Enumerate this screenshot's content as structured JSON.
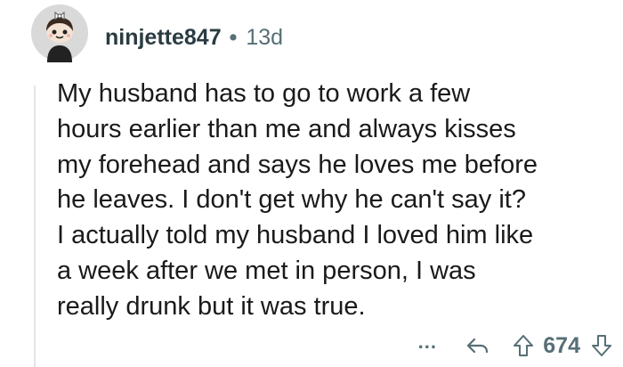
{
  "comment": {
    "author": "ninjette847",
    "separator": "•",
    "age": "13d",
    "body": "My husband has to go to work a few\nhours earlier than me and always kisses\nmy forehead and says he loves me before\nhe leaves.  I don't get why he can't say it?\nI actually told my husband I loved him like\na week after we met in person, I was\nreally drunk but it was true.",
    "avatar_icon": "snoo-avatar-with-bow-icon"
  },
  "actions": {
    "more_label": "...",
    "more_icon": "ellipsis-icon",
    "reply_icon": "reply-arrow-icon",
    "upvote_icon": "upvote-arrow-icon",
    "score": "674",
    "downvote_icon": "downvote-arrow-icon"
  },
  "colors": {
    "text": "#1a1a1b",
    "meta": "#576f76",
    "thread_line": "#e3e5e8",
    "avatar_bg": "#d9d9d9"
  }
}
